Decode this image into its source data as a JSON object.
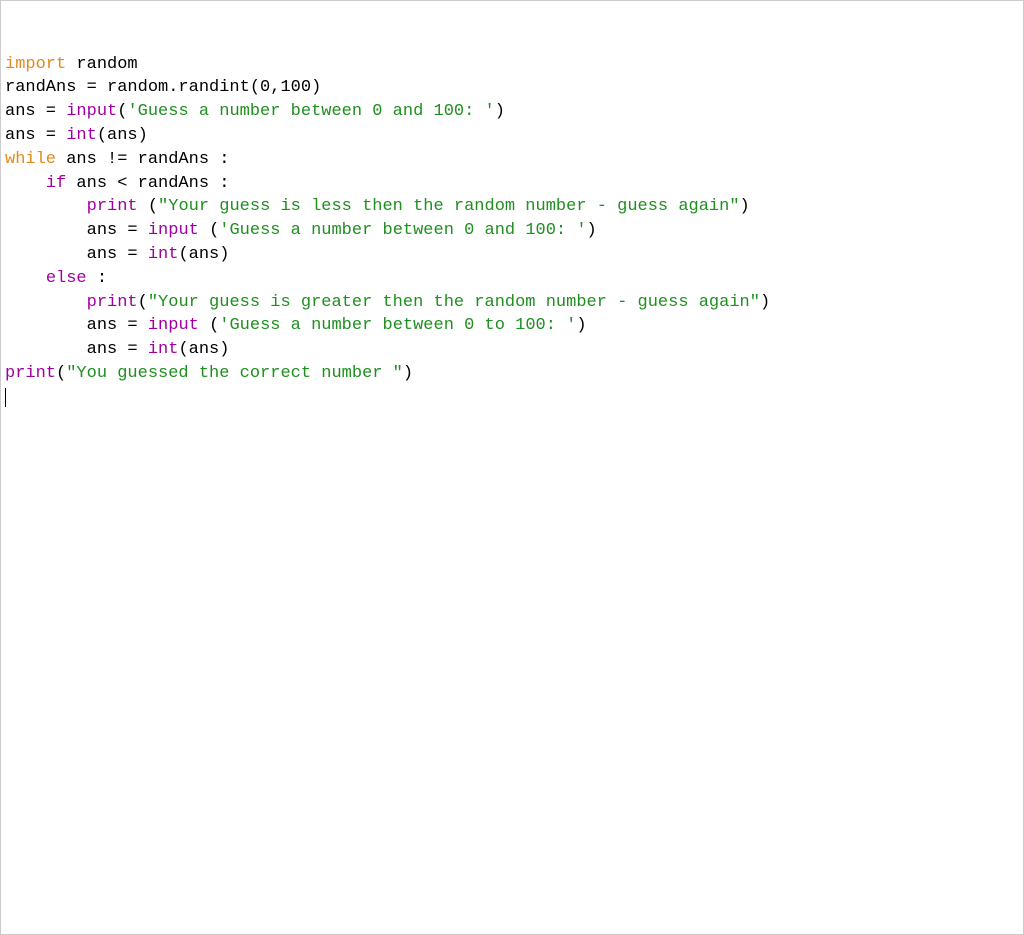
{
  "code": {
    "l1": {
      "kimport": "import",
      "mod": " random"
    },
    "l2": {
      "a": "randAns = random.randint(",
      "n1": "0",
      "c1": ",",
      "n2": "100",
      "close": ")"
    },
    "l3": {
      "a": "ans = ",
      "fn": "input",
      "op": "(",
      "s": "'Guess a number between 0 and 100: '",
      "cl": ")"
    },
    "l4": {
      "a": "ans = ",
      "fn": "int",
      "op": "(ans)"
    },
    "l5": {
      "kw": "while",
      "rest": " ans != randAns :"
    },
    "l6": {
      "kw": "if",
      "rest": " ans < randAns :"
    },
    "l7": {
      "fn": "print",
      "sp": " ",
      "op": "(",
      "s": "\"Your guess is less then the random number - guess again\"",
      "cl": ")"
    },
    "l8": {
      "a": "ans = ",
      "fn": "input",
      "sp": " ",
      "op": "(",
      "s": "'Guess a number between 0 and 100: '",
      "cl": ")"
    },
    "l9": {
      "a": "ans = ",
      "fn": "int",
      "op": "(ans)"
    },
    "l10": {
      "kw": "else",
      "rest": " :"
    },
    "l11": {
      "fn": "print",
      "op": "(",
      "s": "\"Your guess is greater then the random number - guess again\"",
      "cl": ")"
    },
    "l12": {
      "a": "ans = ",
      "fn": "input",
      "sp": " ",
      "op": "(",
      "s": "'Guess a number between 0 to 100: '",
      "cl": ")"
    },
    "l13": {
      "a": "ans = ",
      "fn": "int",
      "op": "(ans)"
    },
    "l14": {
      "fn": "print",
      "op": "(",
      "s": "\"You guessed the correct number \"",
      "cl": ")"
    }
  },
  "indent": {
    "one": "    ",
    "two": "        "
  }
}
